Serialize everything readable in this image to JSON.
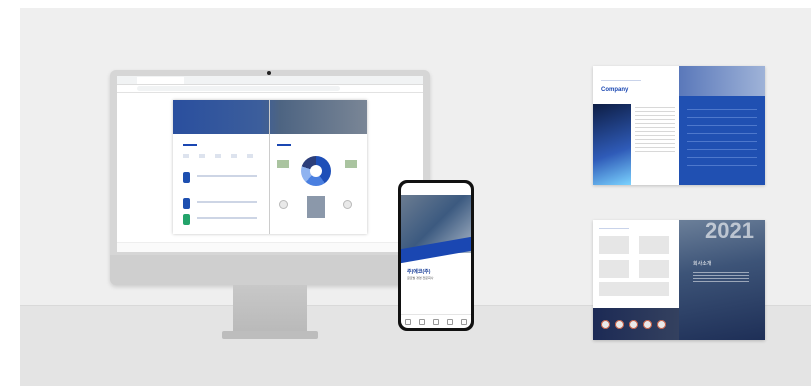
{
  "browser": {
    "tab_title": "",
    "url": ""
  },
  "monitor_doc": {
    "logo": "",
    "hero_title": ""
  },
  "phone": {
    "title": "주)에코(주)",
    "subtitle": "글로벌 경영 전문회사"
  },
  "spread_top": {
    "heading": "Company"
  },
  "spread_bottom": {
    "year": "2021",
    "heading": "회사소개"
  },
  "colors": {
    "brand_blue": "#1a47b2",
    "dark_navy": "#1e2a55",
    "accent": "#c3573d",
    "background": "#efefef"
  }
}
